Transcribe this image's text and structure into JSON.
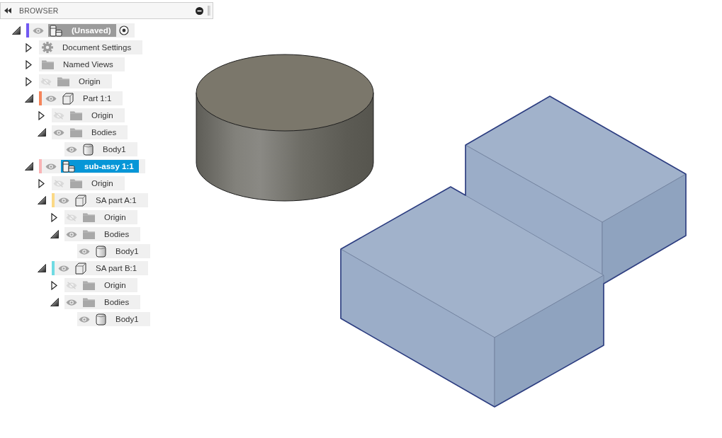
{
  "browser": {
    "title": "BROWSER",
    "tree": [
      {
        "label": "(Unsaved)",
        "kind": "assembly",
        "color": "#7159f2",
        "visible": true,
        "expanded": true,
        "active": true,
        "selected": false,
        "children": [
          {
            "label": "Document Settings",
            "kind": "settings",
            "expanded": false,
            "selected": false
          },
          {
            "label": "Named Views",
            "kind": "folder",
            "expanded": false,
            "selected": false
          },
          {
            "label": "Origin",
            "kind": "folder",
            "visible": false,
            "expanded": false,
            "selected": false
          },
          {
            "label": "Part 1:1",
            "kind": "part",
            "color": "#f5845a",
            "visible": true,
            "expanded": true,
            "active": false,
            "selected": false,
            "children": [
              {
                "label": "Origin",
                "kind": "folder",
                "visible": false,
                "expanded": false,
                "selected": false
              },
              {
                "label": "Bodies",
                "kind": "folder",
                "visible": true,
                "expanded": true,
                "selected": false,
                "children": [
                  {
                    "label": "Body1",
                    "kind": "body",
                    "visible": true,
                    "selected": false
                  }
                ]
              }
            ]
          },
          {
            "label": "sub-assy 1:1",
            "kind": "assembly",
            "color": "#f9b4b6",
            "visible": true,
            "expanded": true,
            "active": false,
            "selected": true,
            "children": [
              {
                "label": "Origin",
                "kind": "folder",
                "visible": false,
                "expanded": false,
                "selected": false
              },
              {
                "label": "SA part A:1",
                "kind": "part",
                "color": "#fbd985",
                "visible": true,
                "expanded": true,
                "active": false,
                "selected": false,
                "children": [
                  {
                    "label": "Origin",
                    "kind": "folder",
                    "visible": false,
                    "expanded": false,
                    "selected": false
                  },
                  {
                    "label": "Bodies",
                    "kind": "folder",
                    "visible": true,
                    "expanded": true,
                    "selected": false,
                    "children": [
                      {
                        "label": "Body1",
                        "kind": "body",
                        "visible": true,
                        "selected": false
                      }
                    ]
                  }
                ]
              },
              {
                "label": "SA part B:1",
                "kind": "part",
                "color": "#6fdbe3",
                "visible": true,
                "expanded": true,
                "active": false,
                "selected": false,
                "children": [
                  {
                    "label": "Origin",
                    "kind": "folder",
                    "visible": false,
                    "expanded": false,
                    "selected": false
                  },
                  {
                    "label": "Bodies",
                    "kind": "folder",
                    "visible": true,
                    "expanded": true,
                    "selected": false,
                    "children": [
                      {
                        "label": "Body1",
                        "kind": "body",
                        "visible": true,
                        "selected": false
                      }
                    ]
                  }
                ]
              }
            ]
          }
        ]
      }
    ]
  }
}
